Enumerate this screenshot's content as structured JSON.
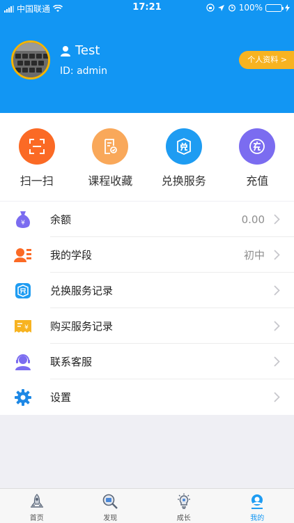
{
  "status_bar": {
    "carrier": "中国联通",
    "time": "17:21",
    "battery": "100%"
  },
  "profile": {
    "name": "Test",
    "id_text": "ID: admin",
    "profile_button": "个人资料 >"
  },
  "actions": [
    {
      "label": "扫一扫",
      "icon": "scan-icon",
      "color": "#fb6a25"
    },
    {
      "label": "课程收藏",
      "icon": "favorite-doc-icon",
      "color": "#f9a85a"
    },
    {
      "label": "兑换服务",
      "icon": "exchange-icon",
      "color": "#1e9cf2"
    },
    {
      "label": "充值",
      "icon": "recharge-icon",
      "color": "#7b6cf0"
    }
  ],
  "menu": [
    {
      "label": "余额",
      "value": "0.00",
      "icon": "money-bag-icon"
    },
    {
      "label": "我的学段",
      "value": "初中",
      "icon": "student-card-icon"
    },
    {
      "label": "兑换服务记录",
      "value": "",
      "icon": "exchange-record-icon"
    },
    {
      "label": "购买服务记录",
      "value": "",
      "icon": "purchase-record-icon"
    },
    {
      "label": "联系客服",
      "value": "",
      "icon": "customer-service-icon"
    },
    {
      "label": "设置",
      "value": "",
      "icon": "settings-gear-icon"
    }
  ],
  "tabs": [
    {
      "label": "首页",
      "icon": "home-rocket-icon"
    },
    {
      "label": "发现",
      "icon": "discover-magnifier-icon"
    },
    {
      "label": "成长",
      "icon": "growth-bulb-icon"
    },
    {
      "label": "我的",
      "icon": "me-icon",
      "active": true
    }
  ],
  "colors": {
    "header": "#1296f3",
    "profile_button": "#f7b321",
    "active_tab": "#1296f3"
  }
}
